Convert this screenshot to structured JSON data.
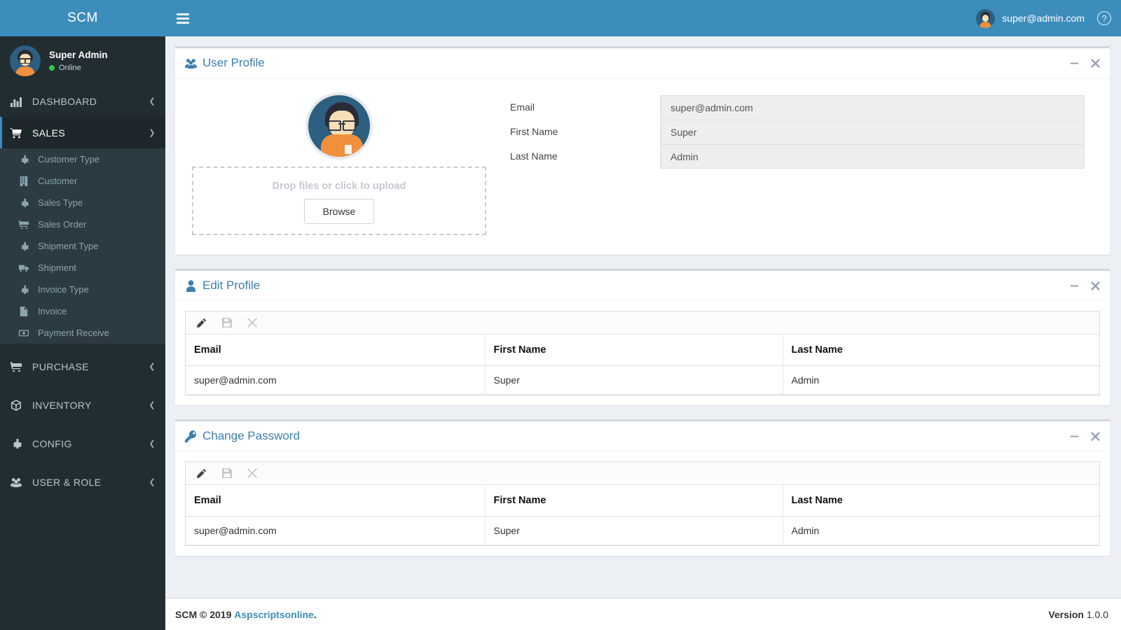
{
  "brand": {
    "title": "SCM"
  },
  "sidebar": {
    "user": {
      "name": "Super Admin",
      "status": "Online",
      "avatar_icon": "user-avatar"
    },
    "nav": [
      {
        "label": "DASHBOARD",
        "icon": "chart-bar-icon",
        "chevron": "left",
        "active": false
      },
      {
        "label": "SALES",
        "icon": "shopping-cart-icon",
        "chevron": "down",
        "active": true
      },
      {
        "label": "PURCHASE",
        "icon": "shopping-cart-icon",
        "chevron": "left",
        "active": false
      },
      {
        "label": "INVENTORY",
        "icon": "cube-icon",
        "chevron": "left",
        "active": false
      },
      {
        "label": "CONFIG",
        "icon": "gear-icon",
        "chevron": "left",
        "active": false
      },
      {
        "label": "USER & ROLE",
        "icon": "users-icon",
        "chevron": "left",
        "active": false
      }
    ],
    "submenu": [
      {
        "label": "Customer Type",
        "icon": "gear-icon"
      },
      {
        "label": "Customer",
        "icon": "building-icon"
      },
      {
        "label": "Sales Type",
        "icon": "gear-icon"
      },
      {
        "label": "Sales Order",
        "icon": "cart-flatbed-icon"
      },
      {
        "label": "Shipment Type",
        "icon": "gear-icon"
      },
      {
        "label": "Shipment",
        "icon": "truck-icon"
      },
      {
        "label": "Invoice Type",
        "icon": "gear-icon"
      },
      {
        "label": "Invoice",
        "icon": "file-icon"
      },
      {
        "label": "Payment Receive",
        "icon": "money-bill-icon"
      }
    ]
  },
  "topbar": {
    "menu_toggle_icon": "hamburger-icon",
    "user_email": "super@admin.com",
    "help_icon": "question-circle-icon"
  },
  "user_profile": {
    "title": "User Profile",
    "title_icon": "users-icon",
    "minimize_icon": "minus-icon",
    "close_icon": "close-icon",
    "avatar_icon": "user-avatar",
    "dropzone": {
      "text": "Drop files or click to upload",
      "browse_label": "Browse"
    },
    "fields": [
      {
        "label": "Email",
        "value": "super@admin.com"
      },
      {
        "label": "First Name",
        "value": "Super"
      },
      {
        "label": "Last Name",
        "value": "Admin"
      }
    ]
  },
  "edit_profile": {
    "title": "Edit Profile",
    "title_icon": "user-icon",
    "minimize_icon": "minus-icon",
    "close_icon": "close-icon",
    "toolbar": [
      {
        "name": "edit",
        "icon": "pencil-icon",
        "enabled": true
      },
      {
        "name": "save",
        "icon": "floppy-disk-icon",
        "enabled": false
      },
      {
        "name": "cancel",
        "icon": "close-icon",
        "enabled": false
      }
    ],
    "columns": [
      "Email",
      "First Name",
      "Last Name"
    ],
    "rows": [
      [
        "super@admin.com",
        "Super",
        "Admin"
      ]
    ]
  },
  "change_password": {
    "title": "Change Password",
    "title_icon": "key-icon",
    "minimize_icon": "minus-icon",
    "close_icon": "close-icon",
    "toolbar": [
      {
        "name": "edit",
        "icon": "pencil-icon",
        "enabled": true
      },
      {
        "name": "save",
        "icon": "floppy-disk-icon",
        "enabled": false
      },
      {
        "name": "cancel",
        "icon": "close-icon",
        "enabled": false
      }
    ],
    "columns": [
      "Email",
      "First Name",
      "Last Name"
    ],
    "rows": [
      [
        "super@admin.com",
        "Super",
        "Admin"
      ]
    ]
  },
  "footer": {
    "copyright": "SCM © 2019",
    "link": "Aspscriptsonline",
    "period": ".",
    "version_label": "Version",
    "version_value": "1.0.0"
  },
  "colors": {
    "brand_blue": "#3c8dbc",
    "sidebar_dark": "#222d32",
    "submenu_bg": "#2c3b41",
    "content_bg": "#ecf0f5",
    "title_blue": "#3c7fb1",
    "online_green": "#2ecc40"
  }
}
